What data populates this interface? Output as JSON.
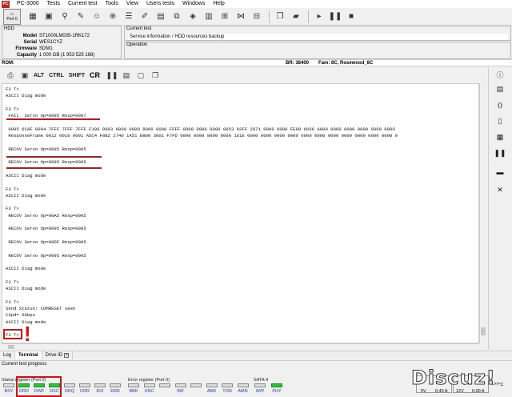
{
  "app": {
    "logo": "PC",
    "title": "PC-3000"
  },
  "menu": [
    "PC-3000",
    "Tests",
    "Current test",
    "Tools",
    "View",
    "Users tests",
    "Windows",
    "Help"
  ],
  "toolbar": {
    "port_label": "Port 0"
  },
  "hdd": {
    "panel_title": "HDD",
    "model_k": "Model",
    "model": "ST1000LM035-1RK172",
    "serial_k": "Serial",
    "serial": "WES1CYZ",
    "firmware_k": "Firmware",
    "firmware": "SDM1",
    "capacity_k": "Capacity",
    "capacity": "1 000 GB (1 953 525 168)"
  },
  "current_test": {
    "title": "Current test",
    "value": "Service information / HDD resources backup"
  },
  "operation": {
    "title": "Operation"
  },
  "rombar": {
    "rom": "ROM:",
    "br": "BR: 38400",
    "family": "Fam: 8C, Rosewood_8C"
  },
  "term_toolbar": {
    "alt": "ALT",
    "ctrl": "CTRL",
    "shift": "SHIFT",
    "cr": "CR"
  },
  "terminal": {
    "lines": [
      "F3 T>",
      "ASCII Diag mode",
      "",
      "F3 T>",
      " FAIL  Servo Op=0095 Resp=0007",
      "",
      " 0095 6CAF 0004 7FFF 7FFF 7FFF F100 0003 0000 0000 8000 0000 FFFF 0D00 0000 0000 0053 02FF 2871 0000 0000 FE90 6666 A000 0000 0000 0000 0000 0000",
      " ResponseFrame 0012 0010 0001 A5C4 F8B2 2740 1A51 EB00 3001 F7FD 0000 0000 0000 0000 161E 0000 0000 0000 0000 0000 0000 0000 0000 0000 0000 0000 0",
      "",
      " RECOV Servo Op=0095 Resp=0005",
      "",
      " RECOV Servo Op=0095 Resp=0005",
      "",
      "ASCII Diag mode",
      "",
      "F3 T>",
      "ASCII Diag mode",
      "",
      "F3 T>",
      " RECOV Servo Op=00A5 Resp=0005",
      "",
      " RECOV Servo Op=0095 Resp=0005",
      "",
      " RECOV Servo Op=00DF Resp=0005",
      "",
      " RECOV Servo Op=0095 Resp=0005",
      "",
      "ASCII Diag mode",
      "",
      "F3 T>",
      "ASCII Diag mode",
      "",
      "F3 T>",
      "Send Status: COMRESET seen",
      "CSpd= 6Gbps",
      "ASCII Diag mode",
      "",
      "F3 T>"
    ]
  },
  "tabs": {
    "log": "Log",
    "terminal": "Terminal",
    "drive_id": "Drive ID"
  },
  "progress": {
    "label": "Current test progress"
  },
  "status": {
    "status_title": "Status register (Port 0)",
    "error_title": "Error register (Port 0)",
    "sata_title": "SATA-II",
    "power_title": "Power 5V",
    "power12_title": "Power 12V",
    "status_leds": [
      {
        "label": "BSY",
        "on": false
      },
      {
        "label": "DRD",
        "on": true
      },
      {
        "label": "DWF",
        "on": true
      },
      {
        "label": "DSC",
        "on": true
      },
      {
        "label": "DRQ",
        "on": false
      },
      {
        "label": "CRR",
        "on": false
      },
      {
        "label": "IDX",
        "on": false
      },
      {
        "label": "ERR",
        "on": false
      }
    ],
    "error_leds": [
      {
        "label": "BBK",
        "on": false
      },
      {
        "label": "UNC",
        "on": false
      },
      {
        "label": "",
        "on": false
      },
      {
        "label": "INF",
        "on": false
      },
      {
        "label": "",
        "on": false
      },
      {
        "label": "ABR",
        "on": false
      },
      {
        "label": "TON",
        "on": false
      },
      {
        "label": "AMN",
        "on": false
      }
    ],
    "sata_leds": [
      {
        "label": "W/P",
        "on": false
      },
      {
        "label": "PHY",
        "on": true
      }
    ],
    "v5": "5V",
    "a5": "0,43 A",
    "v12": "12V",
    "a12": "0,00 A",
    "temp": "+??°C"
  },
  "watermark": "Discuz!",
  "colors": {
    "led_on": "#2ec43a",
    "highlight": "#d01212",
    "led_label": "#1d3fa8"
  }
}
